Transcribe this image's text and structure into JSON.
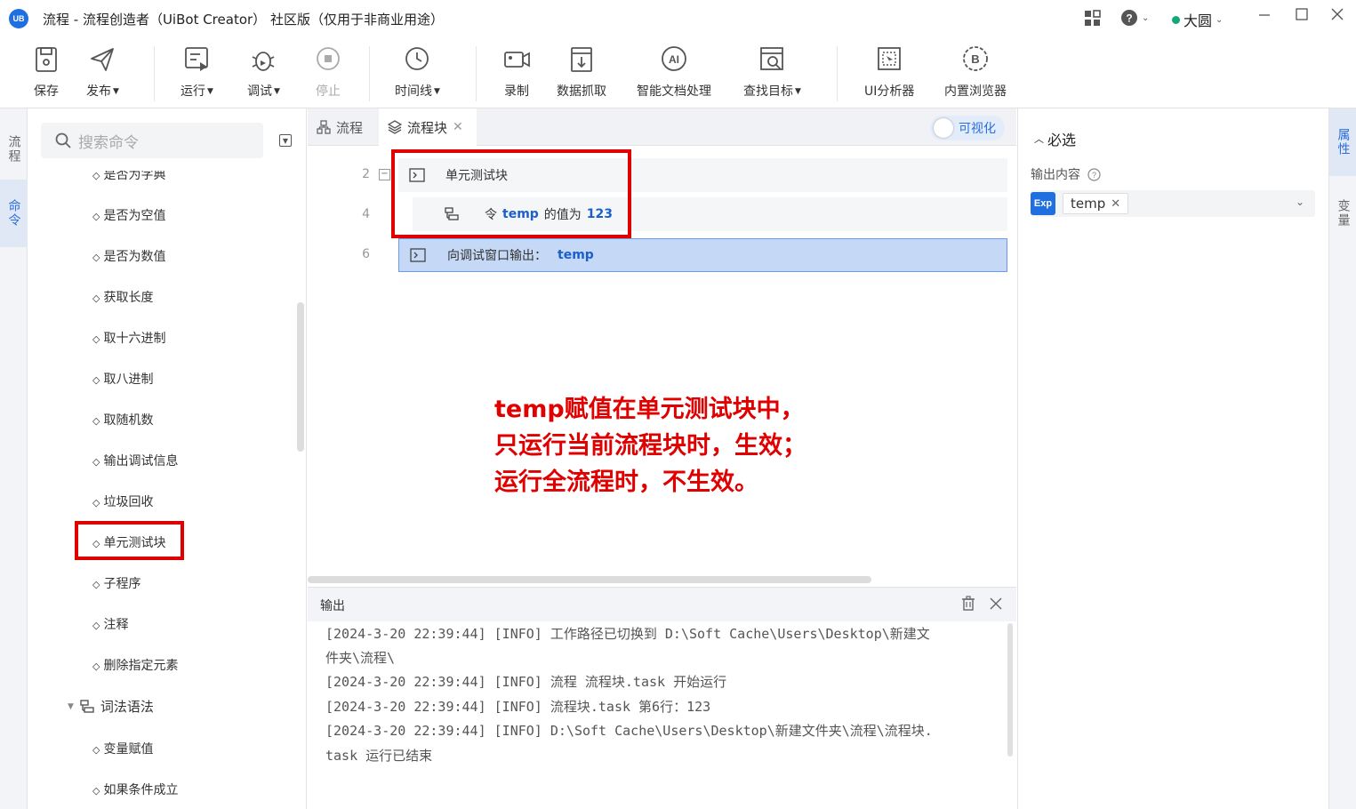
{
  "titlebar": {
    "logo_text": "UB",
    "title": "流程 - 流程创造者（UiBot Creator） 社区版（仅用于非商业用途）",
    "user_name": "大圆"
  },
  "toolbar": {
    "save": "保存",
    "publish": "发布",
    "run": "运行",
    "debug": "调试",
    "stop": "停止",
    "timeline": "时间线",
    "record": "录制",
    "data_scrape": "数据抓取",
    "smart_doc": "智能文档处理",
    "find_target": "查找目标",
    "ui_analyzer": "UI分析器",
    "builtin_browser": "内置浏览器"
  },
  "left_strip": {
    "flow_tab": "流程",
    "command_tab": "命令"
  },
  "command_panel": {
    "search_placeholder": "搜索命令",
    "items": [
      "是否为字典",
      "是否为空值",
      "是否为数值",
      "获取长度",
      "取十六进制",
      "取八进制",
      "取随机数",
      "输出调试信息",
      "垃圾回收",
      "单元测试块",
      "子程序",
      "注释",
      "删除指定元素"
    ],
    "group": "词法语法",
    "group_items": [
      "变量赋值",
      "如果条件成立"
    ]
  },
  "tabs": {
    "flow": "流程",
    "flow_block": "流程块",
    "visual_toggle": "可视化"
  },
  "editor": {
    "lines": [
      {
        "no": "2",
        "text": "单元测试块"
      },
      {
        "no": "4",
        "pre": "令",
        "var": "temp",
        "mid": "的值为",
        "value": "123"
      },
      {
        "no": "6",
        "text": "向调试窗口输出：",
        "var": "temp"
      }
    ],
    "annotation": [
      "temp赋值在单元测试块中，",
      "只运行当前流程块时，生效；",
      "运行全流程时，不生效。"
    ]
  },
  "output": {
    "title": "输出",
    "logs": [
      "[2024-3-20 22:39:44] [INFO] 工作路径已切换到 D:\\Soft Cache\\Users\\Desktop\\新建文",
      "件夹\\流程\\",
      "[2024-3-20 22:39:44] [INFO] 流程 流程块.task 开始运行",
      "[2024-3-20 22:39:44] [INFO] 流程块.task 第6行：123",
      "[2024-3-20 22:39:44] [INFO] D:\\Soft Cache\\Users\\Desktop\\新建文件夹\\流程\\流程块.",
      "task 运行已结束"
    ]
  },
  "properties": {
    "section": "必选",
    "output_label": "输出内容",
    "exp_badge": "Exp",
    "value_chip": "temp"
  },
  "right_strip": {
    "attr_tab": "属性",
    "var_tab": "变量"
  },
  "colors": {
    "accent": "#1f6fe0",
    "highlight_row": "#c5d9f7",
    "annotation_red": "#e00000"
  }
}
